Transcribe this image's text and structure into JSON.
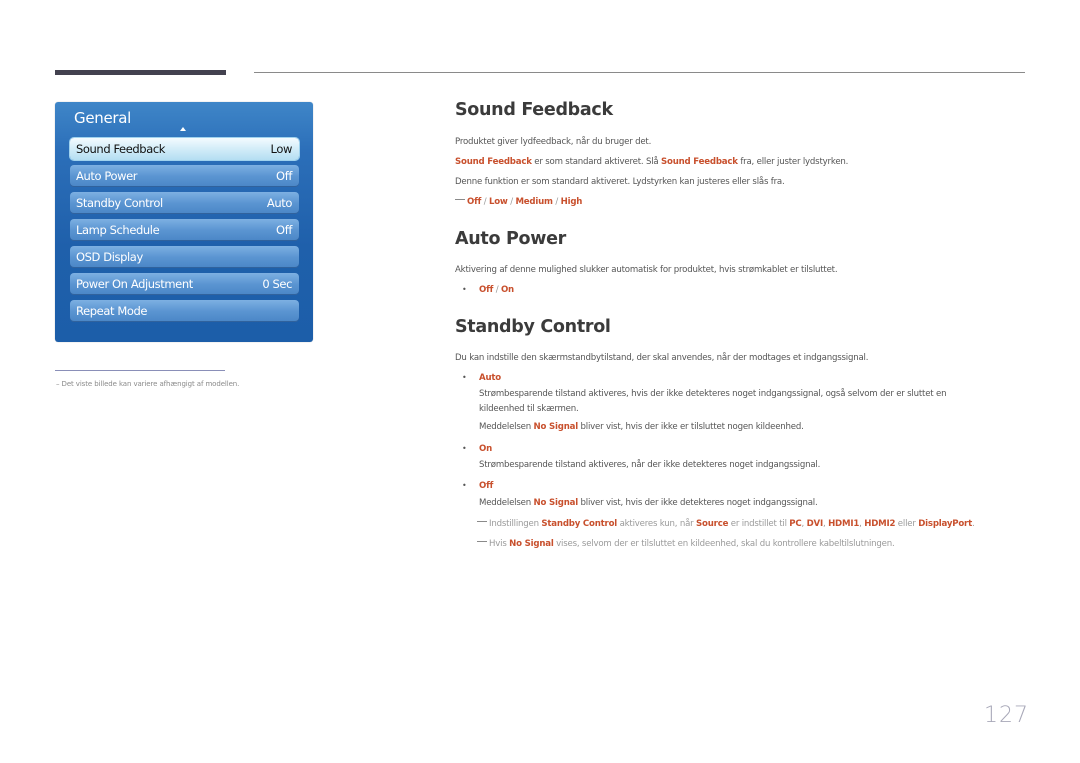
{
  "osd": {
    "title": "General",
    "items": [
      {
        "label": "Sound Feedback",
        "value": "Low",
        "selected": true
      },
      {
        "label": "Auto Power",
        "value": "Off"
      },
      {
        "label": "Standby Control",
        "value": "Auto"
      },
      {
        "label": "Lamp Schedule",
        "value": "Off"
      },
      {
        "label": "OSD Display",
        "value": ""
      },
      {
        "label": "Power On Adjustment",
        "value": "0 Sec"
      },
      {
        "label": "Repeat Mode",
        "value": ""
      }
    ]
  },
  "footnote": "Det viste billede kan variere afhængigt af modellen.",
  "sections": {
    "sound_feedback": {
      "title": "Sound Feedback",
      "p1": "Produktet giver lydfeedback, når du bruger det.",
      "p2_a": "Sound Feedback",
      "p2_b": " er som standard aktiveret. Slå ",
      "p2_c": "Sound Feedback",
      "p2_d": " fra, eller juster lydstyrken.",
      "p3": "Denne funktion er som standard aktiveret. Lydstyrken kan justeres eller slås fra.",
      "options": [
        "Off",
        "Low",
        "Medium",
        "High"
      ],
      "sep": " / "
    },
    "auto_power": {
      "title": "Auto Power",
      "p1": "Aktivering af denne mulighed slukker automatisk for produktet, hvis strømkablet er tilsluttet.",
      "options": [
        "Off",
        "On"
      ]
    },
    "standby_control": {
      "title": "Standby Control",
      "p1": "Du kan indstille den skærmstandbytilstand, der skal anvendes, når der modtages et indgangssignal.",
      "auto_label": "Auto",
      "auto_desc1": "Strømbesparende tilstand aktiveres, hvis der ikke detekteres noget indgangssignal, også selvom der er sluttet en",
      "auto_desc2": "kildeenhed til skærmen.",
      "auto_msg_a": "Meddelelsen ",
      "auto_msg_b": "No Signal",
      "auto_msg_c": " bliver vist, hvis der ikke er tilsluttet nogen kildeenhed.",
      "on_label": "On",
      "on_desc": "Strømbesparende tilstand aktiveres, når der ikke detekteres noget indgangssignal.",
      "off_label": "Off",
      "off_msg_a": "Meddelelsen ",
      "off_msg_b": "No Signal",
      "off_msg_c": " bliver vist, hvis der ikke detekteres noget indgangssignal.",
      "note1": {
        "a": "Indstillingen ",
        "b": "Standby Control",
        "c": " aktiveres kun, når ",
        "d": "Source",
        "e": " er indstillet til ",
        "f": "PC",
        "g": ", ",
        "h": "DVI",
        "i": ", ",
        "j": "HDMI1",
        "k": ", ",
        "l": "HDMI2",
        "m": " eller ",
        "n": "DisplayPort",
        "o": "."
      },
      "note2": {
        "a": "Hvis ",
        "b": "No Signal",
        "c": " vises, selvom der er tilsluttet en kildeenhed, skal du kontrollere kabeltilslutningen."
      }
    }
  },
  "page_number": "127",
  "colors": {
    "accent": "#c8502d",
    "osd_blue": "#1f60ab"
  }
}
